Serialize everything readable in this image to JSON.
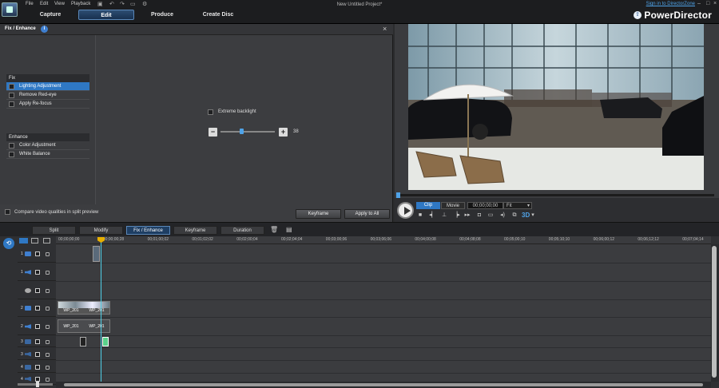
{
  "menu": {
    "file": "File",
    "edit": "Edit",
    "view": "View",
    "playback": "Playback"
  },
  "project_title": "New Untitled Project*",
  "signin": "Sign in to DirectorZone",
  "brand": "PowerDirector",
  "modes": [
    "Capture",
    "Edit",
    "Produce",
    "Create Disc"
  ],
  "panel": {
    "title": "Fix / Enhance",
    "fix_header": "Fix",
    "fix_items": [
      "Lighting Adjustment",
      "Remove Red-eye",
      "Apply Re-focus"
    ],
    "enhance_header": "Enhance",
    "enhance_items": [
      "Color Adjustment",
      "White Balance"
    ],
    "extreme_backlight": "Extreme backlight",
    "slider_value": "38",
    "slider_fraction": 0.38,
    "compare_label": "Compare video qualities in split preview",
    "keyframe_btn": "Keyframe",
    "apply_all_btn": "Apply to All"
  },
  "preview": {
    "clip": "Clip",
    "movie": "Movie",
    "timecode": "00;00;00;00",
    "fit": "Fit",
    "mode_3d": "3D"
  },
  "toolbar_tabs": [
    "Split",
    "Modify",
    "Fix / Enhance",
    "Keyframe",
    "Duration"
  ],
  "timeline": {
    "ticks": [
      "00;00;00;00",
      "00;00;00;28",
      "00;01;00;02",
      "00;01;02;02",
      "00;02;00;04",
      "00;02;04;04",
      "00;03;00;06",
      "00;03;06;06",
      "00;04;00;08",
      "00;04;08;08",
      "00;05;00;10",
      "00;05;10;10",
      "00;06;00;12",
      "00;06;12;12",
      "00;07;04;14"
    ],
    "track_numbers": [
      "1",
      "1",
      "",
      "2",
      "2",
      "3",
      "3",
      "4",
      "4"
    ],
    "clip_label": "WP_201"
  }
}
